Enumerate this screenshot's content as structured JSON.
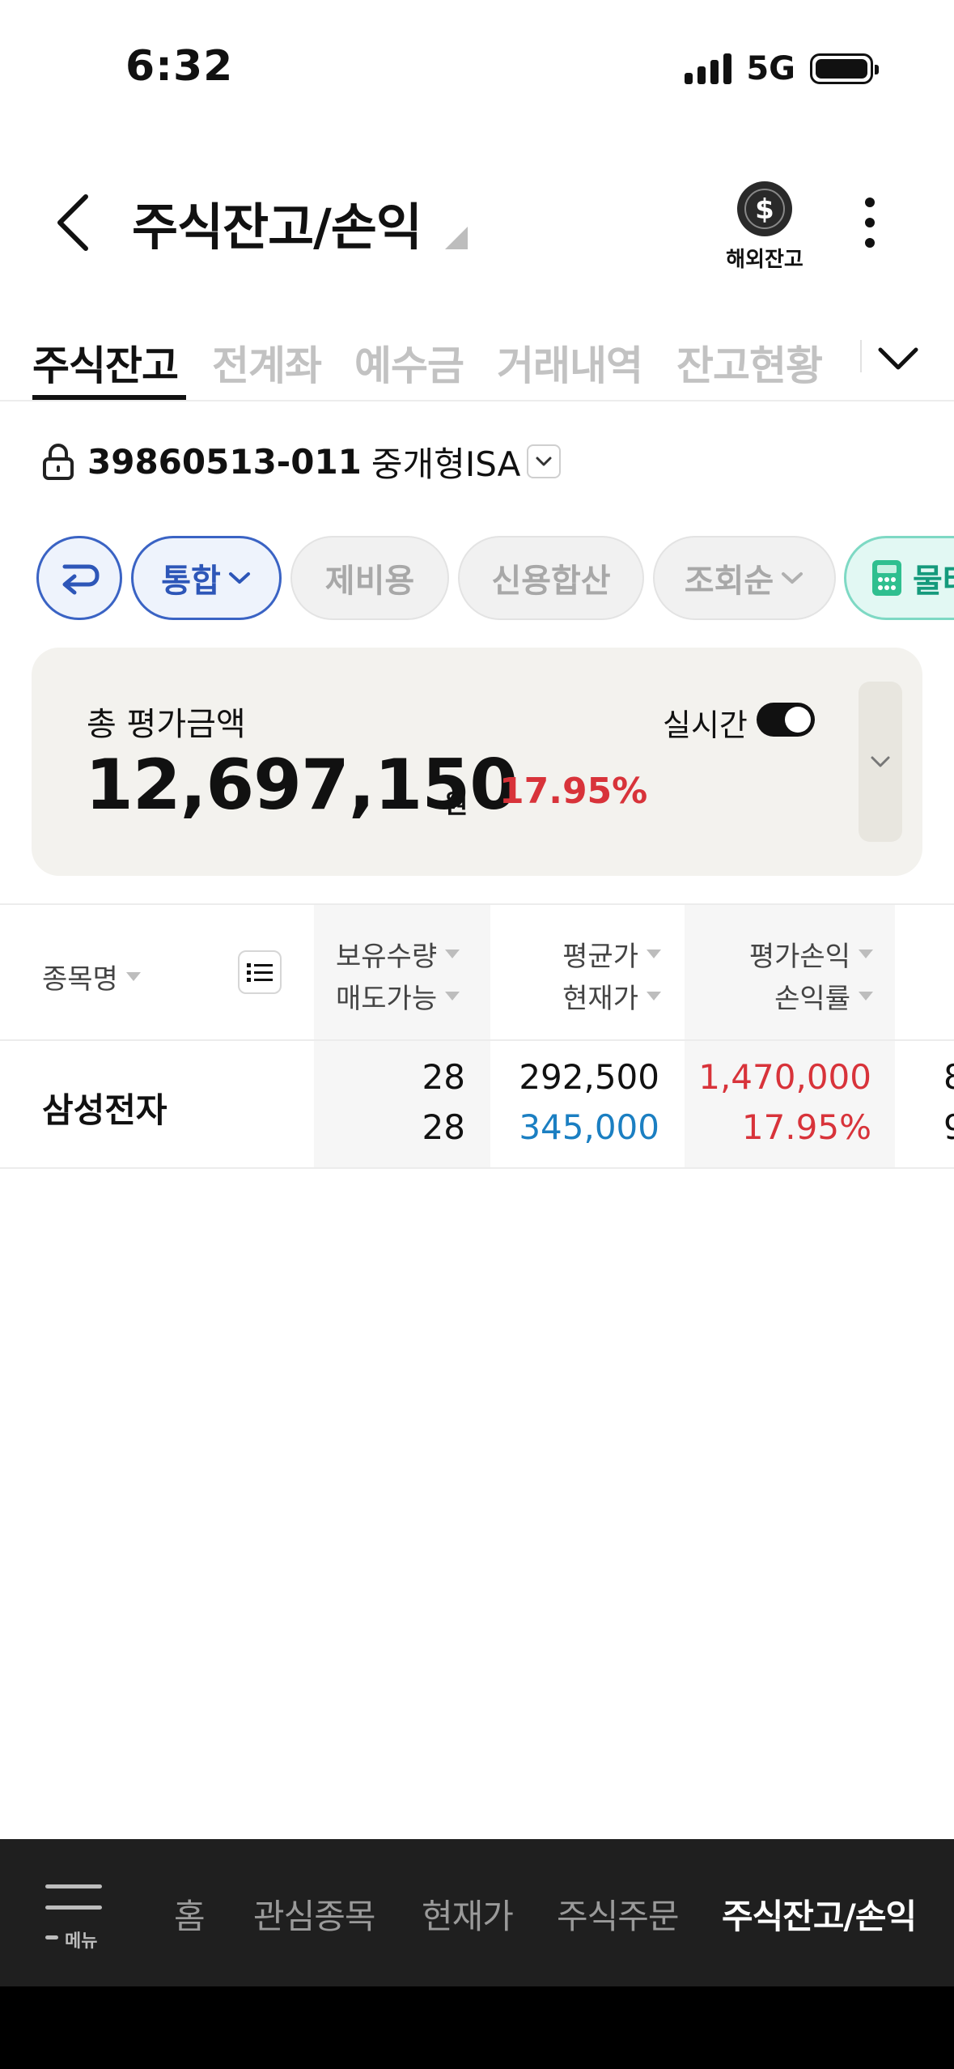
{
  "status_bar": {
    "time": "6:32",
    "network": "5G"
  },
  "header": {
    "title": "주식잔고/손익",
    "overseas_label": "해외잔고"
  },
  "tabs": [
    {
      "label": "주식잔고",
      "active": true
    },
    {
      "label": "전계좌",
      "active": false
    },
    {
      "label": "예수금",
      "active": false
    },
    {
      "label": "거래내역",
      "active": false
    },
    {
      "label": "잔고현황",
      "active": false
    }
  ],
  "account": {
    "number": "39860513-011",
    "type": "중개형ISA"
  },
  "chips": {
    "combined": "통합",
    "fees": "제비용",
    "credit_total": "신용합산",
    "sort_order": "조회순",
    "water": "물타"
  },
  "summary": {
    "label": "총 평가금액",
    "amount": "12,697,150",
    "unit": "원",
    "rate": "17.95%",
    "realtime_label": "실시간",
    "realtime_on": true
  },
  "table": {
    "headers": {
      "name": "종목명",
      "qty": "보유수량",
      "sellable": "매도가능",
      "avg_price": "평균가",
      "current_price": "현재가",
      "pnl": "평가손익",
      "pnl_rate": "손익률"
    },
    "rows": [
      {
        "name": "삼성전자",
        "qty": "28",
        "sellable": "28",
        "avg_price": "292,500",
        "current_price": "345,000",
        "pnl": "1,470,000",
        "pnl_rate": "17.95%",
        "overflow_top": "8",
        "overflow_bottom": "9"
      }
    ]
  },
  "bottom_nav": {
    "menu_label": "메뉴",
    "items": [
      {
        "label": "홈",
        "active": false
      },
      {
        "label": "관심종목",
        "active": false
      },
      {
        "label": "현재가",
        "active": false
      },
      {
        "label": "주식주문",
        "active": false
      },
      {
        "label": "주식잔고/손익",
        "active": true
      }
    ]
  },
  "colors": {
    "up": "#d8333a",
    "down": "#1b7fc2",
    "accent": "#3a63c4",
    "card_bg": "#f3f2ee",
    "nav_bg": "#1f1f1f"
  }
}
